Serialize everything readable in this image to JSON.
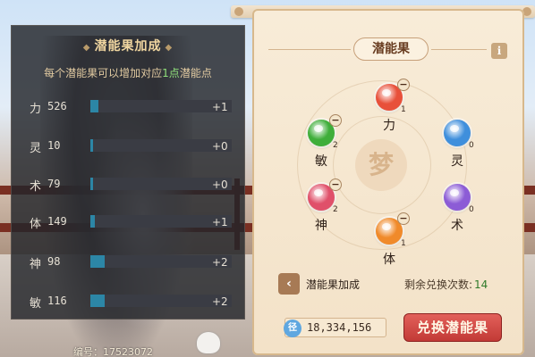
{
  "stats_panel": {
    "title": "潜能果加成",
    "subtitle_pre": "每个潜能果可以增加对应",
    "subtitle_highlight": "1点",
    "subtitle_post": "潜能点",
    "rows": [
      {
        "name": "力",
        "value": "526",
        "bonus": "+1",
        "fill_fraction": 0.06
      },
      {
        "name": "灵",
        "value": "10",
        "bonus": "+0",
        "fill_fraction": 0.02
      },
      {
        "name": "术",
        "value": "79",
        "bonus": "+0",
        "fill_fraction": 0.02
      },
      {
        "name": "体",
        "value": "149",
        "bonus": "+1",
        "fill_fraction": 0.03
      },
      {
        "name": "神",
        "value": "98",
        "bonus": "+2",
        "fill_fraction": 0.1
      },
      {
        "name": "敏",
        "value": "116",
        "bonus": "+2",
        "fill_fraction": 0.1
      }
    ]
  },
  "serial": "编号：17523072",
  "fruit_panel": {
    "title": "潜能果",
    "info_label": "i",
    "center_glyph": "梦",
    "minus_label": "−",
    "fruits": [
      {
        "id": "li",
        "label": "力",
        "count": "1",
        "color": "#e8503a"
      },
      {
        "id": "min",
        "label": "敏",
        "count": "2",
        "color": "#3fae3a"
      },
      {
        "id": "ling",
        "label": "灵",
        "count": "0",
        "color": "#3f8fdc"
      },
      {
        "id": "shen",
        "label": "神",
        "count": "2",
        "color": "#e0506a"
      },
      {
        "id": "shu",
        "label": "术",
        "count": "0",
        "color": "#8c5cd6"
      },
      {
        "id": "ti",
        "label": "体",
        "count": "1",
        "color": "#f08a2a"
      }
    ],
    "back_label": "潜能果加成",
    "back_icon": "‹",
    "remaining_label": "剩余兑换次数:",
    "remaining_count": "14",
    "currency_icon": "径",
    "currency_amount": "18,334,156",
    "exchange_label": "兑换潜能果"
  }
}
